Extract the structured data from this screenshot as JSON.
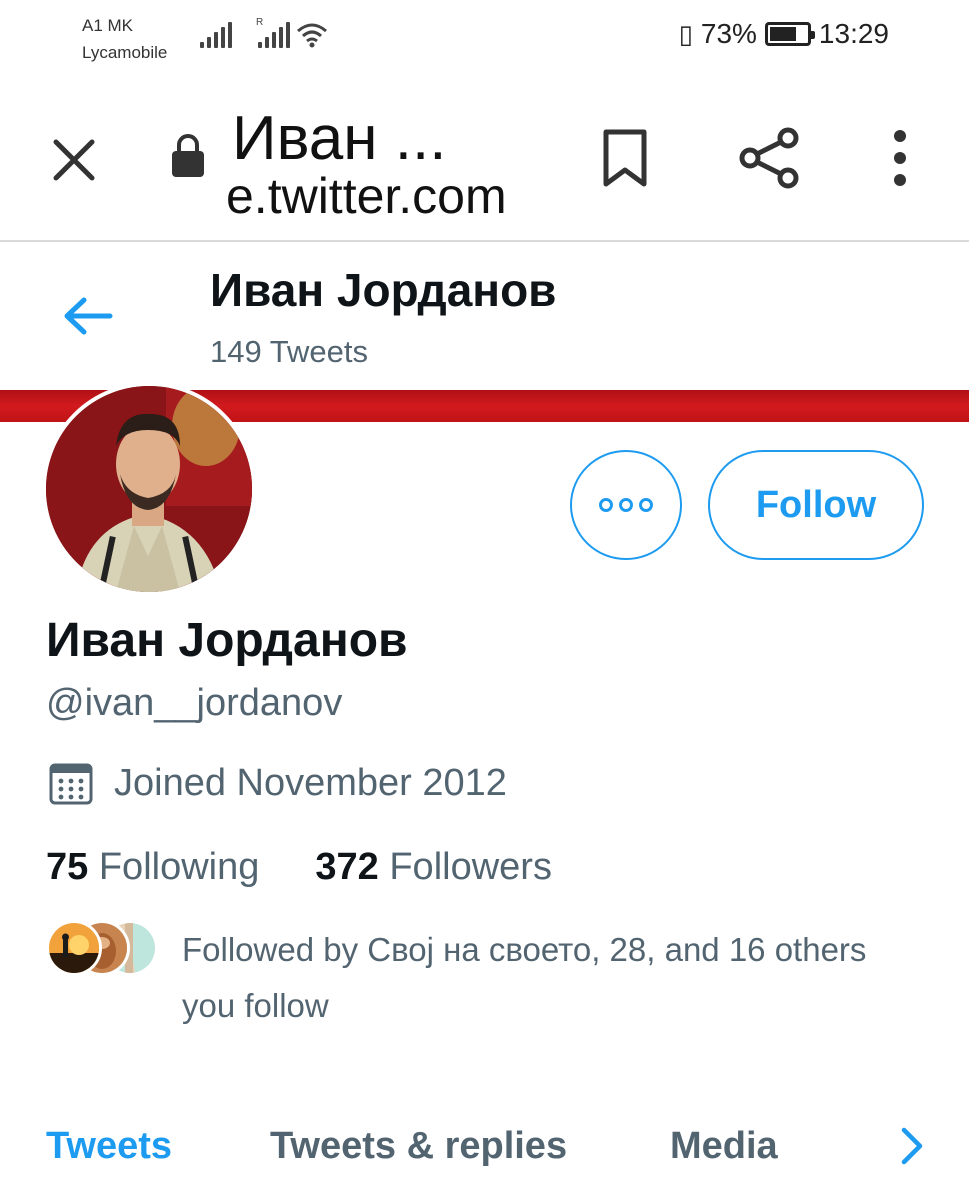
{
  "status_bar": {
    "carrier_line1": "A1 MK",
    "carrier_line2": "Lycamobile",
    "roaming_indicator": "R",
    "battery_percent": "73%",
    "battery_level": 0.73,
    "time": "13:29",
    "icons": [
      "signal-icon",
      "signal-icon",
      "wifi-icon",
      "vibrate-icon",
      "battery-icon"
    ]
  },
  "browser": {
    "page_title": "Иван ...",
    "url": "e.twitter.com",
    "icons": [
      "close-icon",
      "lock-icon",
      "bookmark-icon",
      "share-icon",
      "more-vertical-icon"
    ]
  },
  "header": {
    "name": "Иван Јорданов",
    "tweet_count": "149 Tweets",
    "icons": [
      "back-arrow-icon"
    ]
  },
  "profile": {
    "display_name": "Иван Јорданов",
    "handle": "@ivan__jordanov",
    "joined": "Joined November 2012",
    "following_count": "75",
    "following_label": "Following",
    "followers_count": "372",
    "followers_label": "Followers",
    "followed_by": "Followed by Свој на своето, 28, and 16 others you follow",
    "follow_button": "Follow",
    "icons": [
      "calendar-icon",
      "more-horizontal-icon"
    ]
  },
  "tabs": [
    {
      "label": "Tweets",
      "active": true
    },
    {
      "label": "Tweets & replies",
      "active": false
    },
    {
      "label": "Media",
      "active": false
    }
  ],
  "colors": {
    "accent": "#1d9bf0",
    "text_primary": "#0f1419",
    "text_secondary": "#536471",
    "banner": "#c81a1e"
  }
}
